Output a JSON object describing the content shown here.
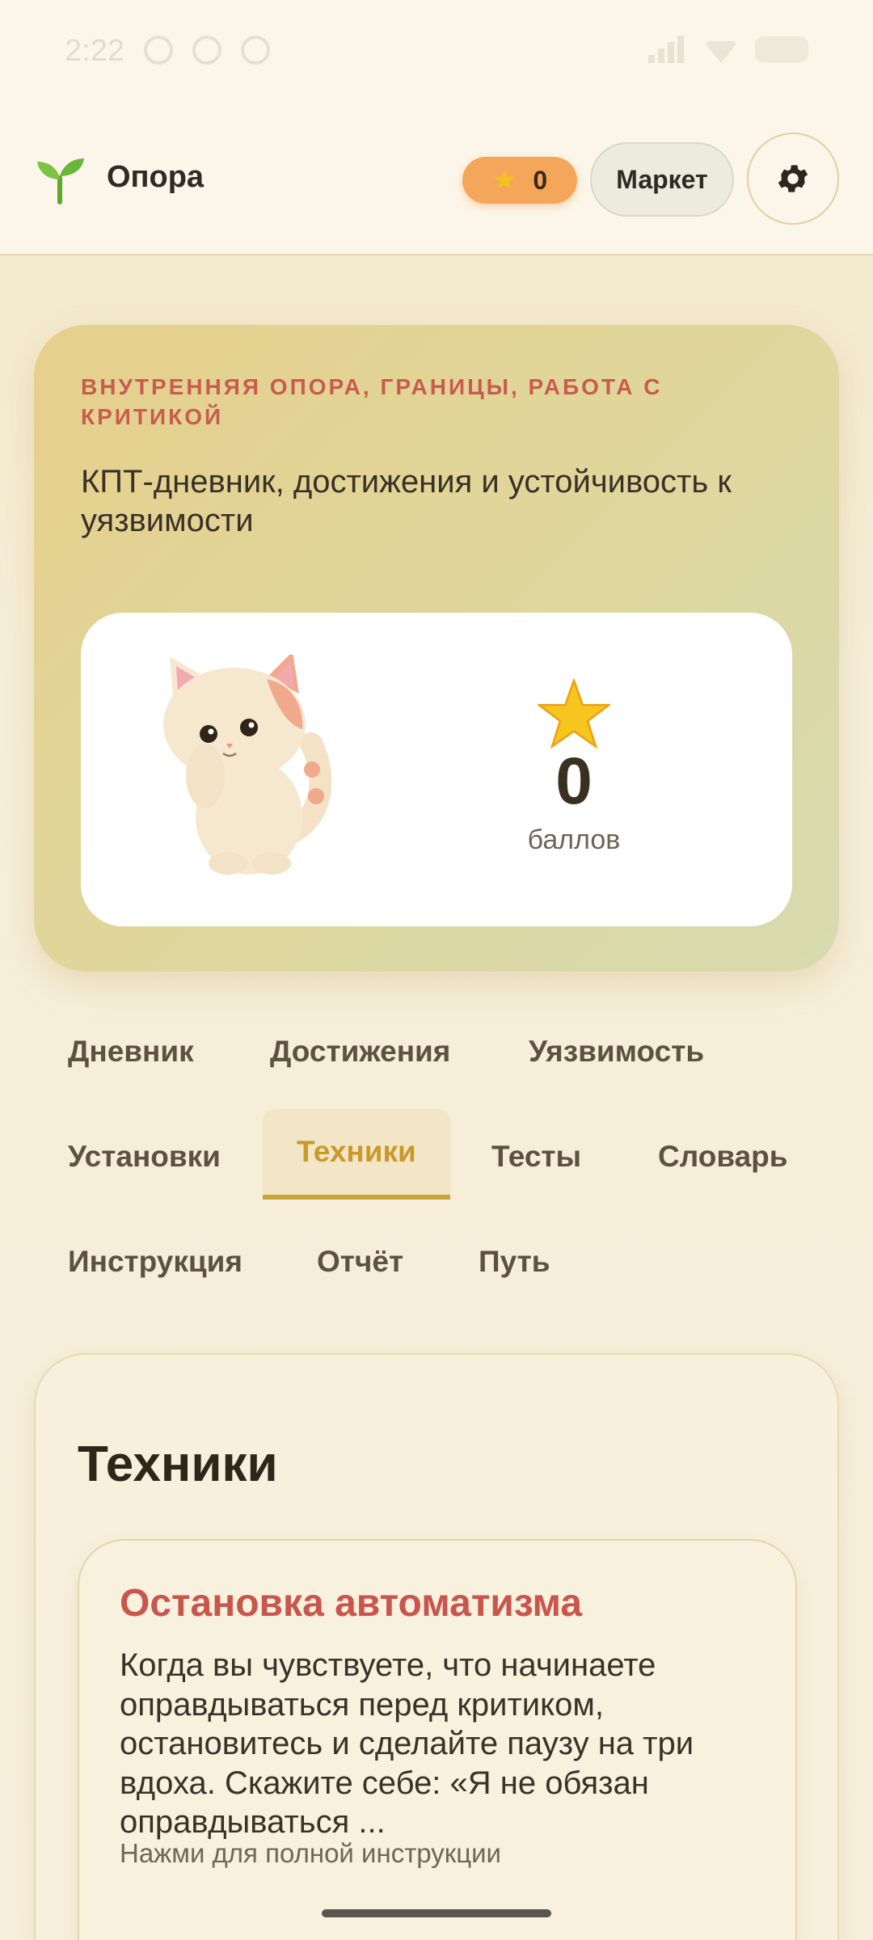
{
  "status_bar": {
    "time": "2:22"
  },
  "header": {
    "app_title": "Опора",
    "points": "0",
    "market_label": "Маркет",
    "settings_icon": "gear-icon",
    "logo_icon": "sprout-icon"
  },
  "hero": {
    "kicker": "ВНУТРЕННЯЯ ОПОРА, ГРАНИЦЫ, РАБОТА С КРИТИКОЙ",
    "description": "КПТ-дневник, достижения и устойчивость к уязвимости",
    "points": "0",
    "points_label": "баллов",
    "mascot": "cat-mascot"
  },
  "tabs": [
    {
      "label": "Дневник"
    },
    {
      "label": "Достижения"
    },
    {
      "label": "Уязвимость"
    },
    {
      "label": "Установки"
    },
    {
      "label": "Техники"
    },
    {
      "label": "Тесты"
    },
    {
      "label": "Словарь"
    },
    {
      "label": "Инструкция"
    },
    {
      "label": "Отчёт"
    },
    {
      "label": "Путь"
    }
  ],
  "active_tab": "Техники",
  "content": {
    "title": "Техники",
    "technique": {
      "title": "Остановка автоматизма",
      "text": "Когда вы чувствуете, что начинаете оправдываться перед критиком, остановитесь и сделайте паузу на три вдоха. Скажите себе: «Я не обязан оправдываться ...",
      "hint": "Нажми для полной инструкции"
    }
  },
  "colors": {
    "accent_red": "#c9564d",
    "accent_gold": "#c9a53d",
    "points_pill": "#f4a65a"
  }
}
